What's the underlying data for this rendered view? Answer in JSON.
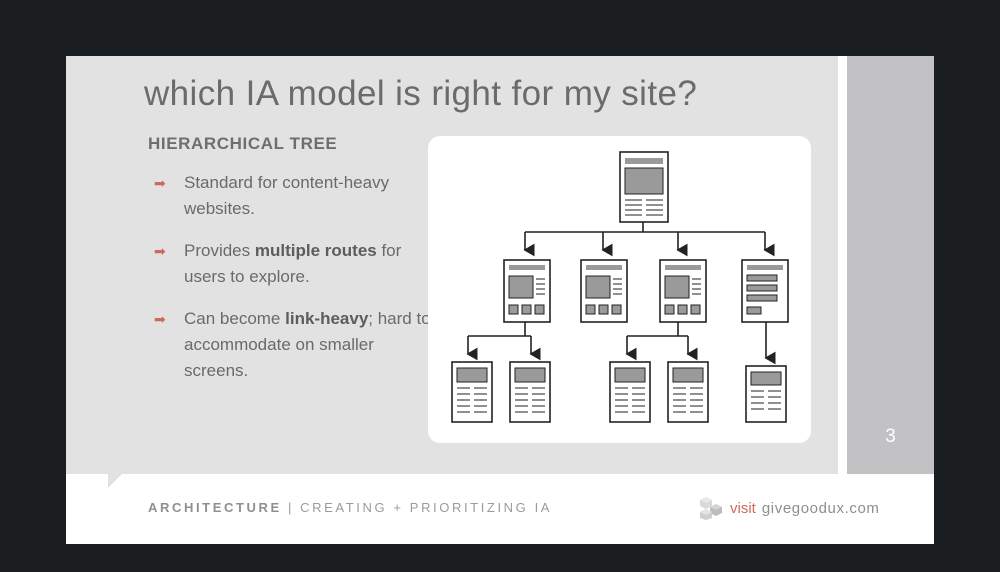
{
  "slide": {
    "title": "which IA model is right for my site?",
    "subtitle": "HIERARCHICAL TREE",
    "page_number": "3",
    "bullets": [
      {
        "pre": "Standard for content-heavy websites.",
        "strong": "",
        "post": ""
      },
      {
        "pre": "Provides ",
        "strong": "multiple routes",
        "post": " for users to explore."
      },
      {
        "pre": "Can become ",
        "strong": "link-heavy",
        "post": "; hard to accommodate  on smaller screens."
      }
    ],
    "footer": {
      "section": "ARCHITECTURE",
      "separator": " | ",
      "topic": "CREATING + PRIORITIZING IA",
      "visit": "visit",
      "domain": "givegoodux.com"
    }
  },
  "colors": {
    "accent": "#d1695a",
    "panel": "#e2e2e2",
    "sidebar": "#c2c1c3"
  },
  "icons": {
    "bullet": "right-arrow-icon",
    "logo": "cube-cluster-logo"
  }
}
